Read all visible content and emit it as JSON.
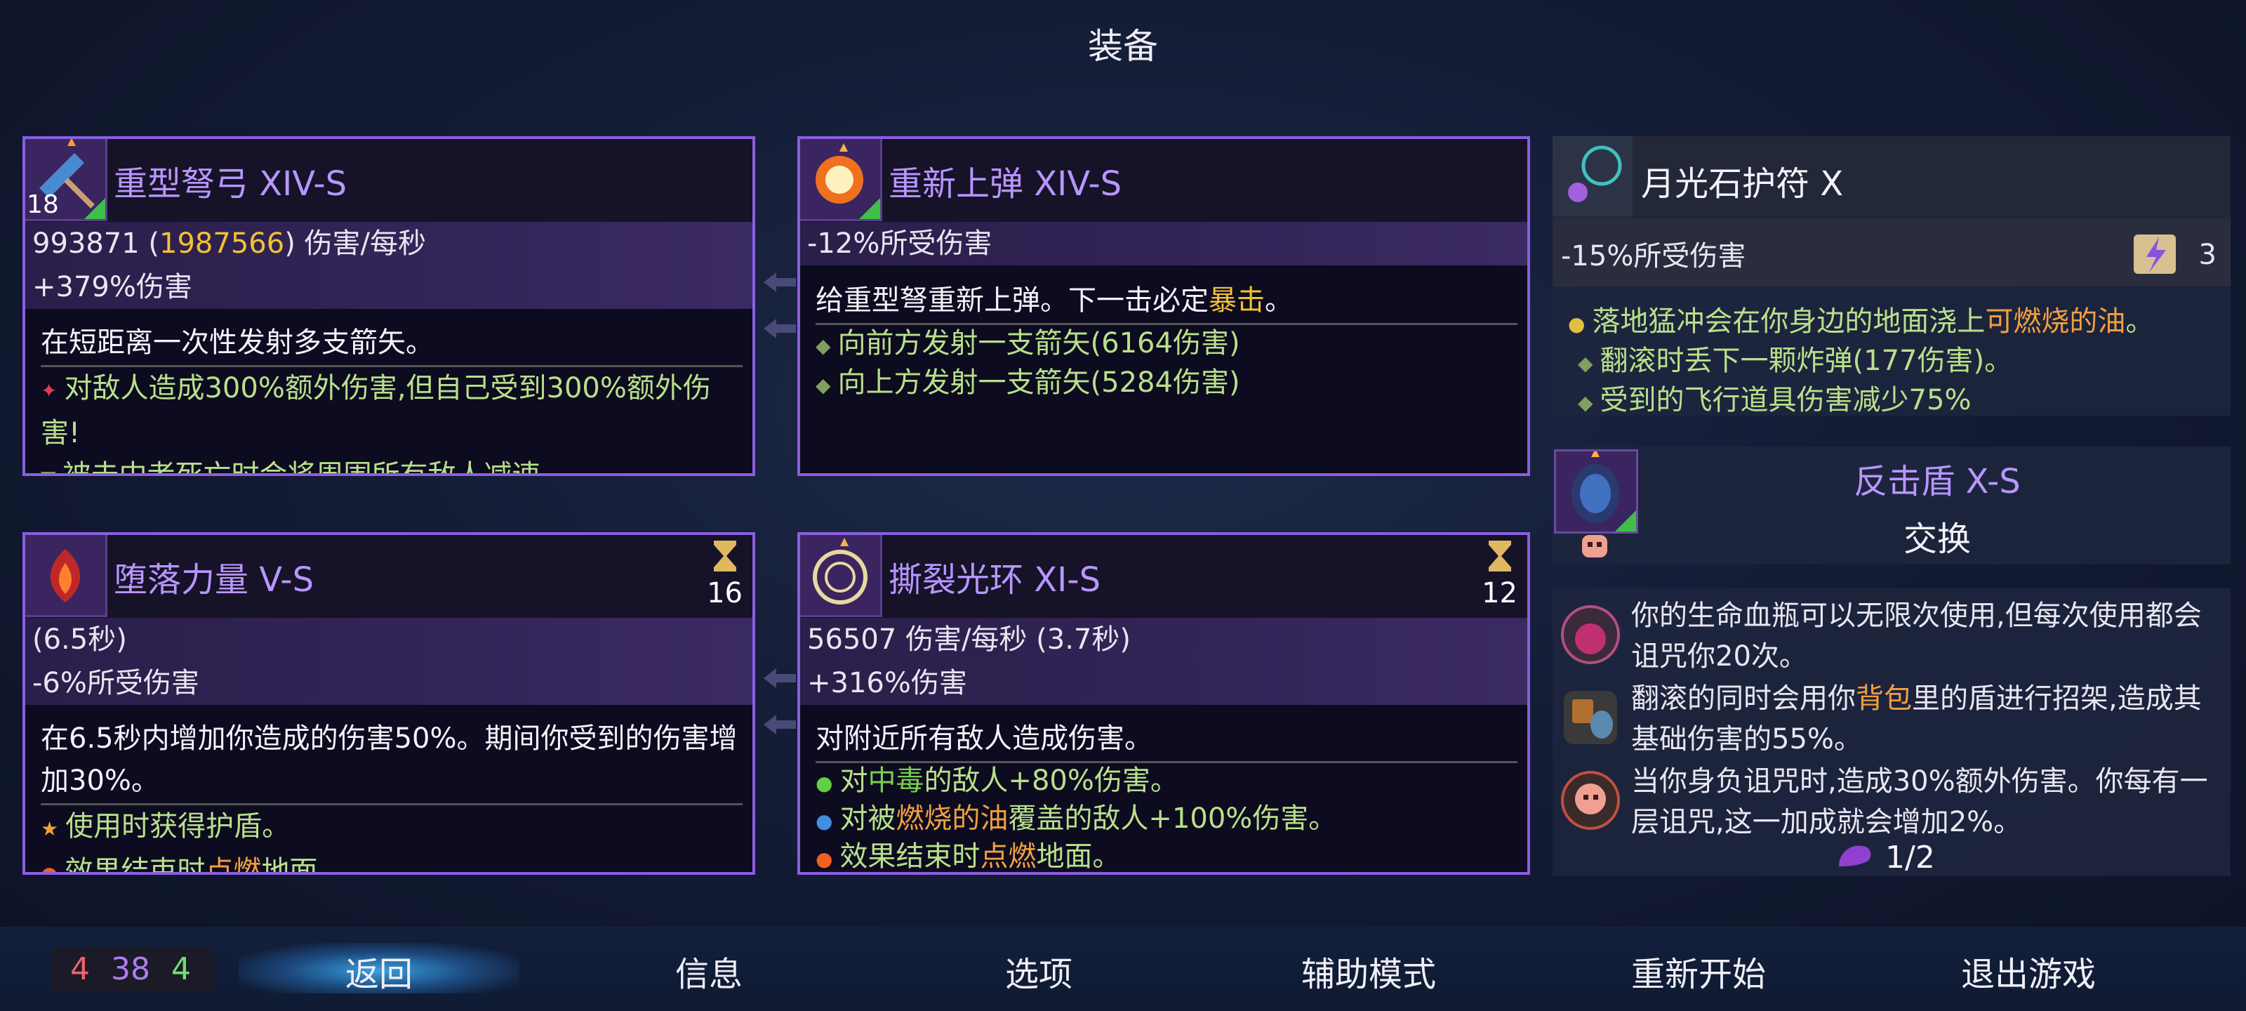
{
  "screen_title": "装备",
  "weapons": [
    {
      "name": "重型弩弓 XIV-S",
      "level": "18",
      "dps": "993871",
      "dps_crit": "1987566",
      "dps_unit": "伤害/每秒",
      "stat2": "+379%伤害",
      "desc": "在短距离一次性发射多支箭矢。",
      "effect1": "对敌人造成300%额外伤害,但自己受到300%额外伤害!",
      "effect2": "被击中者死亡时会将周围所有敌人减速"
    },
    {
      "name": "重新上弹 XIV-S",
      "stat1": "-12%所受伤害",
      "desc_pre": "给重型弩重新上弹。下一击必定",
      "desc_hl": "暴击",
      "desc_post": "。",
      "effect1": "向前方发射一支箭矢(6164伤害)",
      "effect2": "向上方发射一支箭矢(5284伤害)"
    },
    {
      "name": "堕落力量 V-S",
      "timer": "16",
      "stat1": "(6.5秒)",
      "stat2": "-6%所受伤害",
      "desc": "在6.5秒内增加你造成的伤害50%。期间你受到的伤害增加30%。",
      "effect1": "使用时获得护盾。",
      "effect2_pre": "效果结束时",
      "effect2_hl": "点燃",
      "effect2_post": "地面"
    },
    {
      "name": "撕裂光环 XI-S",
      "timer": "12",
      "stat1": "56507 伤害/每秒 (3.7秒)",
      "stat2": "+316%伤害",
      "desc": "对附近所有敌人造成伤害。",
      "effect1_pre": "对",
      "effect1_hl": "中毒",
      "effect1_post": "的敌人+80%伤害。",
      "effect2_pre": "对被",
      "effect2_hl": "燃烧的油",
      "effect2_post": "覆盖的敌人+100%伤害。",
      "effect3_pre": "效果结束时",
      "effect3_hl": "点燃",
      "effect3_post": "地面。"
    }
  ],
  "amulet": {
    "name": "月光石护符 X",
    "stat1": "-15%所受伤害",
    "scroll_count": "3",
    "effect1_pre": "落地猛冲会在你身边的地面浇上",
    "effect1_hl": "可燃烧的油",
    "effect1_post": "。",
    "effect2": "翻滚时丢下一颗炸弹(177伤害)。",
    "effect3": "受到的飞行道具伤害减少75%"
  },
  "swap_item": {
    "name": "反击盾 X-S",
    "action": "交换"
  },
  "mutations": [
    {
      "text": "你的生命血瓶可以无限次使用,但每次使用都会诅咒你20次。"
    },
    {
      "text_pre": "翻滚的同时会用你",
      "text_hl": "背包",
      "text_post": "里的盾进行招架,造成其基础伤害的55%。"
    },
    {
      "text": "当你身负诅咒时,造成30%额外伤害。你每有一层诅咒,这一加成就会增加2%。"
    }
  ],
  "mutation_counter": "1/2",
  "scroll_counts": {
    "red": "4",
    "purple": "38",
    "green": "4"
  },
  "menu": {
    "back": "返回",
    "info": "信息",
    "options": "选项",
    "assist": "辅助模式",
    "restart": "重新开始",
    "quit": "退出游戏"
  },
  "colors": {
    "card_border": "#8a5ee0",
    "highlight_gold": "#f1c232",
    "effect_green": "#b8e08a",
    "highlight_orange": "#f0a040"
  }
}
